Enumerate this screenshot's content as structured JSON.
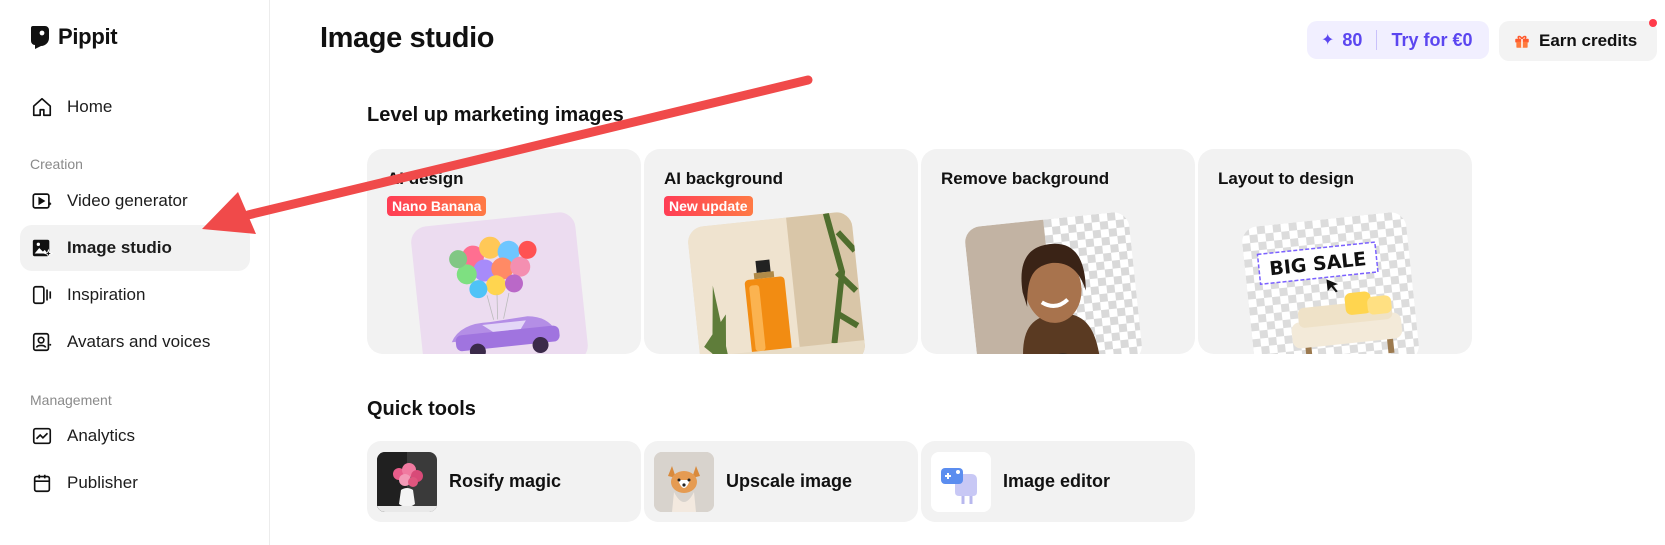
{
  "app": {
    "name": "Pippit"
  },
  "sidebar": {
    "home": "Home",
    "creation_heading": "Creation",
    "items_creation": [
      {
        "label": "Video generator",
        "icon": "video-play-icon"
      },
      {
        "label": "Image studio",
        "icon": "image-sparkle-icon",
        "active": true
      },
      {
        "label": "Inspiration",
        "icon": "inspiration-icon"
      },
      {
        "label": "Avatars and voices",
        "icon": "avatar-icon"
      }
    ],
    "management_heading": "Management",
    "items_management": [
      {
        "label": "Analytics",
        "icon": "analytics-icon"
      },
      {
        "label": "Publisher",
        "icon": "calendar-icon"
      }
    ]
  },
  "header": {
    "title": "Image studio",
    "credits": "80",
    "try_label": "Try for €0",
    "earn_label": "Earn credits"
  },
  "marketing": {
    "title": "Level up marketing images",
    "cards": [
      {
        "title": "AI design",
        "badge": "Nano Banana"
      },
      {
        "title": "AI background",
        "badge": "New update"
      },
      {
        "title": "Remove background",
        "badge": ""
      },
      {
        "title": "Layout to design",
        "badge": "",
        "art_text": "BIG SALE"
      }
    ]
  },
  "quick_tools": {
    "title": "Quick tools",
    "items": [
      {
        "label": "Rosify magic"
      },
      {
        "label": "Upscale image"
      },
      {
        "label": "Image editor"
      }
    ]
  },
  "colors": {
    "accent": "#5b46f0",
    "badge": "#ff4d4f",
    "arrow": "#f04a4a"
  }
}
